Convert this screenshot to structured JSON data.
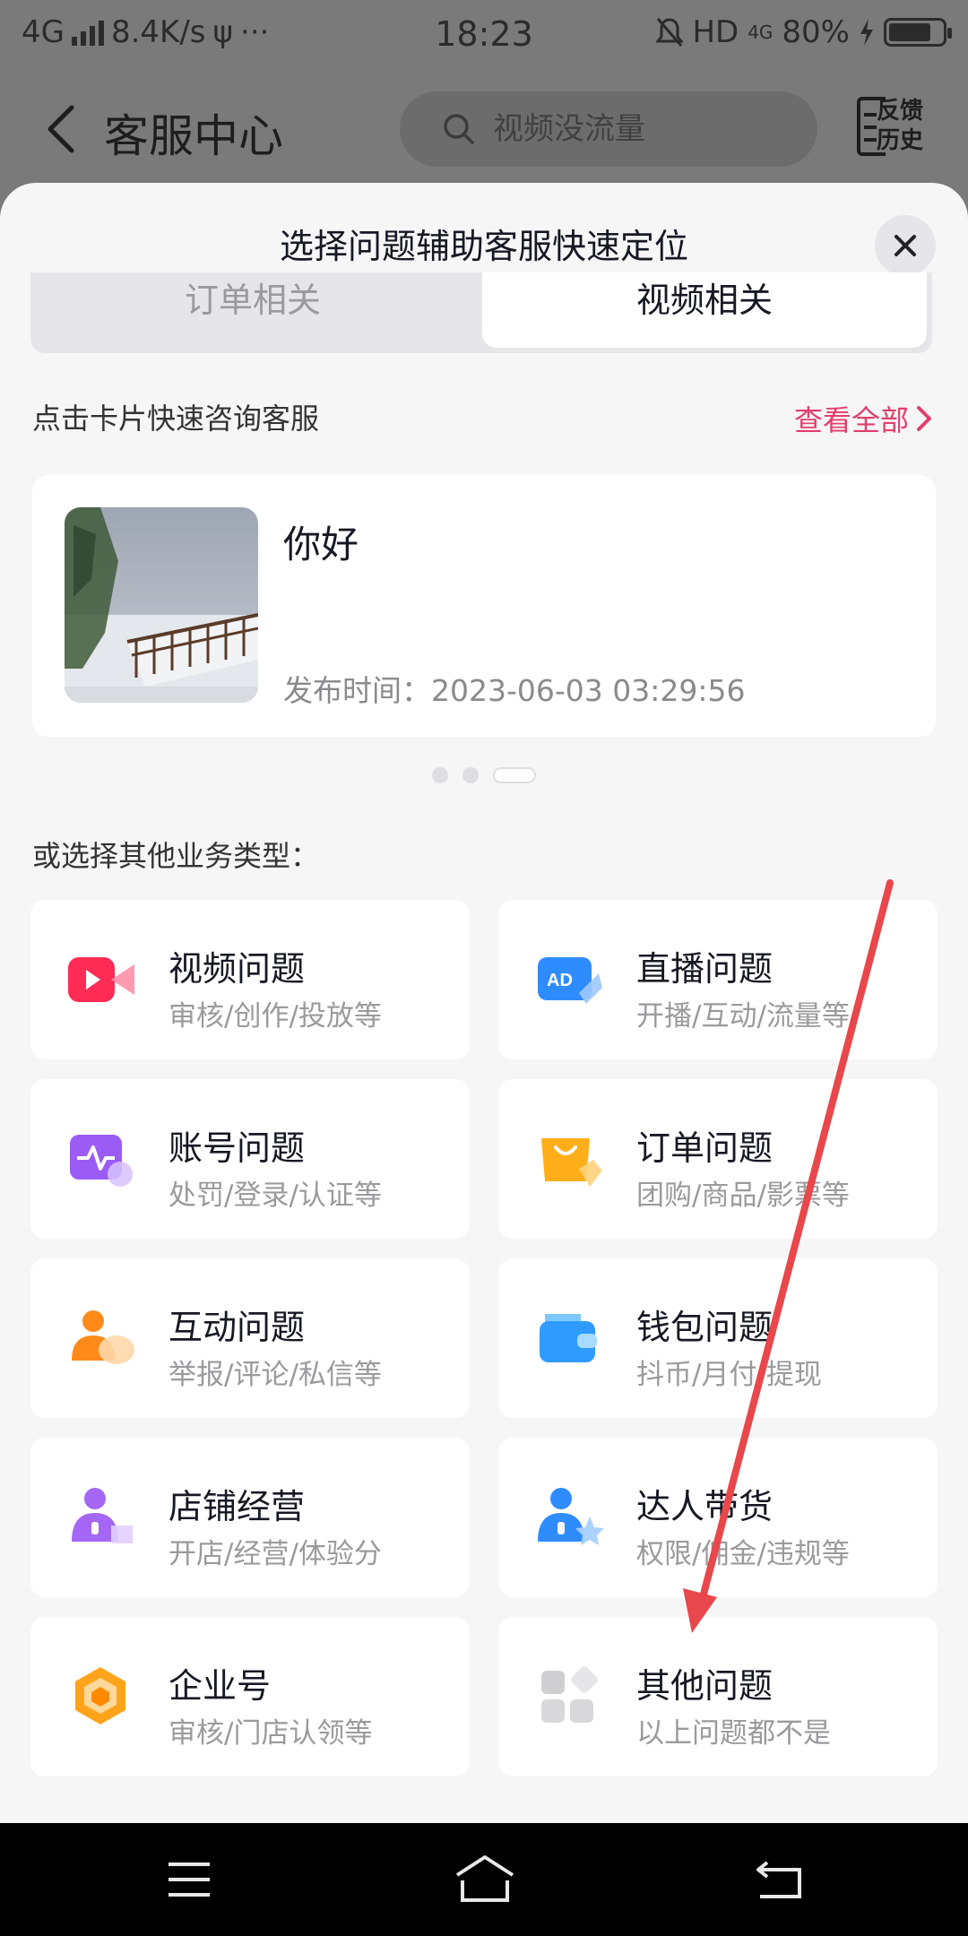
{
  "status_bar": {
    "network": "4G",
    "speed": "8.4K/s",
    "usb": "ψ",
    "more": "···",
    "time": "18:23",
    "hd": "HD",
    "net_right": "4G",
    "battery": "80%",
    "battery_level": 0.8
  },
  "header": {
    "title": "客服中心",
    "search_placeholder": "视频没流量",
    "history_label_1": "反馈",
    "history_label_2": "历史"
  },
  "sheet": {
    "title": "选择问题辅助客服快速定位",
    "tabs": [
      {
        "label": "订单相关",
        "selected": false
      },
      {
        "label": "视频相关",
        "selected": true
      }
    ],
    "quick_label": "点击卡片快速咨询客服",
    "view_all": "查看全部",
    "video_card": {
      "title": "你好",
      "publish_time": "发布时间：2023-06-03 03:29:56"
    },
    "page_dots": 3,
    "active_dot": 2,
    "other_label": "或选择其他业务类型：",
    "categories": [
      {
        "name": "视频问题",
        "desc": "审核/创作/投放等",
        "icon": "video-icon"
      },
      {
        "name": "直播问题",
        "desc": "开播/互动/流量等",
        "icon": "ad-icon"
      },
      {
        "name": "账号问题",
        "desc": "处罚/登录/认证等",
        "icon": "account-icon"
      },
      {
        "name": "订单问题",
        "desc": "团购/商品/影票等",
        "icon": "shopping-bag-icon"
      },
      {
        "name": "互动问题",
        "desc": "举报/评论/私信等",
        "icon": "interaction-icon"
      },
      {
        "name": "钱包问题",
        "desc": "抖币/月付/提现",
        "icon": "wallet-icon"
      },
      {
        "name": "店铺经营",
        "desc": "开店/经营/体验分",
        "icon": "shop-icon"
      },
      {
        "name": "达人带货",
        "desc": "权限/佣金/违规等",
        "icon": "creator-icon"
      },
      {
        "name": "企业号",
        "desc": "审核/门店认领等",
        "icon": "enterprise-icon"
      },
      {
        "name": "其他问题",
        "desc": "以上问题都不是",
        "icon": "grid-icon"
      }
    ]
  },
  "colors": {
    "accent": "#e33e6b",
    "annotation_arrow": "#e8474b"
  }
}
